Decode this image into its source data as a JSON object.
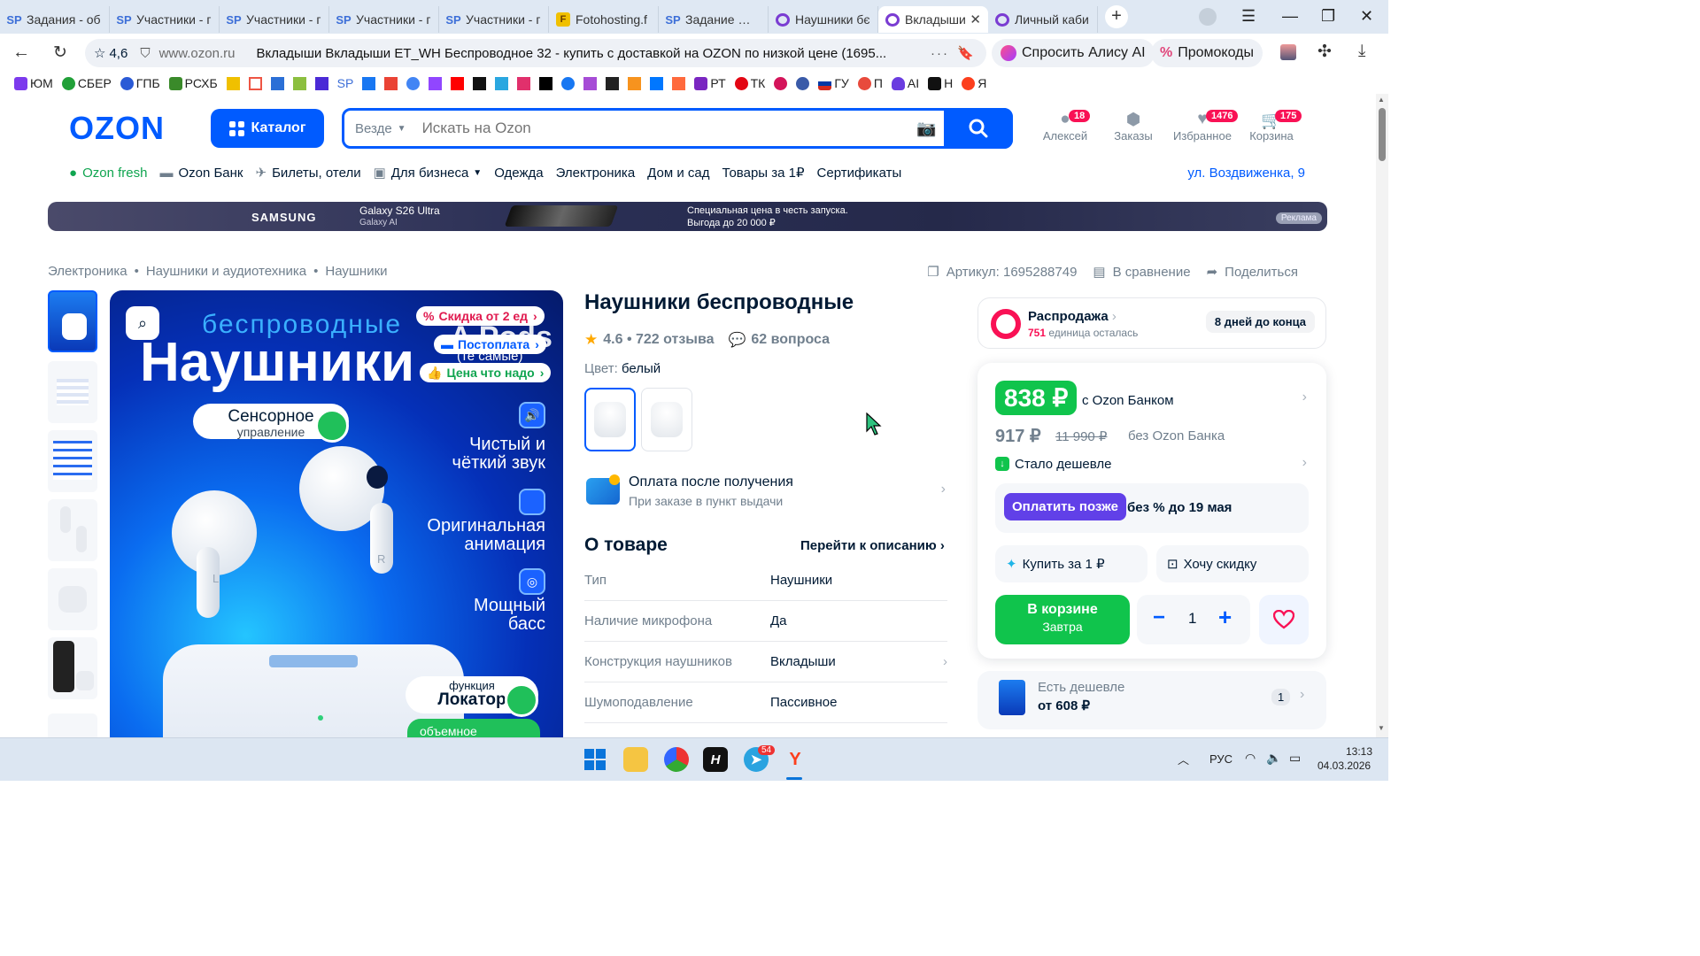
{
  "browser": {
    "tabs": [
      {
        "fav": "SP",
        "title": "Задания - об"
      },
      {
        "fav": "SP",
        "title": "Участники - г"
      },
      {
        "fav": "SP",
        "title": "Участники - г"
      },
      {
        "fav": "SP",
        "title": "Участники - г"
      },
      {
        "fav": "SP",
        "title": "Участники - г"
      },
      {
        "fav": "F",
        "title": "Fotohosting.f"
      },
      {
        "fav": "SP",
        "title": "Задание №2("
      },
      {
        "fav": "",
        "title": "Наушники бє"
      },
      {
        "fav": "",
        "title": "Вкладыши"
      },
      {
        "fav": "",
        "title": "Личный каби"
      }
    ],
    "rating_badge": "4,6",
    "url_domain": "www.ozon.ru",
    "page_title": "Вкладыши Вкладыши ET_WH Беспроводное 32 - купить с доставкой на OZON по низкой цене (1695...",
    "alice_label": "Спросить Алису AI",
    "promo_label": "Промокоды",
    "bookmarks": [
      "ЮМ",
      "СБЕР",
      "ГПБ",
      "РСХБ",
      "SP",
      "РТ",
      "ТК",
      "ГУ",
      "П",
      "AI",
      "Н",
      "Я"
    ]
  },
  "header": {
    "logo": "OZON",
    "catalog_label": "Каталог",
    "search_scope": "Везде",
    "search_placeholder": "Искать на Ozon",
    "profile_label": "Алексей",
    "profile_badge": "18",
    "orders_label": "Заказы",
    "favorites_label": "Избранное",
    "favorites_badge": "1476",
    "cart_label": "Корзина",
    "cart_badge": "175"
  },
  "nav": {
    "items": [
      "Ozon fresh",
      "Ozon Банк",
      "Билеты, отели",
      "Для бизнеса",
      "Одежда",
      "Электроника",
      "Дом и сад",
      "Товары за 1₽",
      "Сертификаты"
    ],
    "address": "ул. Воздвиженка, 9"
  },
  "banner": {
    "brand": "SAMSUNG",
    "model": "Galaxy S26 Ultra",
    "model_sub": "Galaxy AI",
    "offer_line1": "Специальная цена в честь запуска.",
    "offer_line2": "Выгода до 20 000 ₽",
    "ad_label": "Реклама"
  },
  "breadcrumbs": [
    "Электроника",
    "Наушники и аудиотехника",
    "Наушники"
  ],
  "meta": {
    "article": "Артикул: 1695288749",
    "compare": "В сравнение",
    "share": "Поделиться"
  },
  "hero": {
    "word_top": "беспроводные",
    "word_main": "Наушники",
    "word_ghost": "A Pods",
    "word_ghost_sub": "(те самые)",
    "chip_discount": "Скидка от 2 ед",
    "chip_postpay": "Постоплата",
    "chip_price": "Цена что надо",
    "sensor_title": "Сенсорное",
    "sensor_sub": "управление",
    "feature1": "Чистый и чёткий звук",
    "feature2": "Оригинальная анимация",
    "feature3": "Мощный басс",
    "locator_top": "функция",
    "locator_main": "Локатор",
    "bottom_badge": "объемное",
    "earbud_left": "L",
    "earbud_right": "R"
  },
  "product": {
    "title": "Наушники беспроводные",
    "rating": "4.6 • 722 отзыва",
    "questions": "62 вопроса",
    "color_label": "Цвет:",
    "color_value": "белый",
    "pay_after_title": "Оплата после получения",
    "pay_after_sub": "При заказе в пункт выдачи",
    "about_title": "О товаре",
    "about_link": "Перейти к описанию",
    "specs": [
      {
        "k": "Тип",
        "v": "Наушники"
      },
      {
        "k": "Наличие микрофона",
        "v": "Да"
      },
      {
        "k": "Конструкция наушников",
        "v": "Вкладыши"
      },
      {
        "k": "Шумоподавление",
        "v": "Пассивное"
      }
    ]
  },
  "buy": {
    "sale_title": "Распродажа",
    "sale_count": "751",
    "sale_rest": "единица осталась",
    "sale_deadline": "8 дней до конца",
    "price_bank": "838 ₽",
    "price_bank_label": "с Ozon Банком",
    "price": "917 ₽",
    "price_old": "11 990 ₽",
    "price_label": "без Ozon Банка",
    "cheaper_badge": "Стало дешевле",
    "pay_later_btn": "Оплатить позже",
    "pay_later_text": "без % до 19 мая",
    "buy_for_1": "Купить за 1 ₽",
    "want_discount": "Хочу скидку",
    "in_cart": "В корзине",
    "in_cart_sub": "Завтра",
    "qty": "1",
    "cheaper_title": "Есть дешевле",
    "cheaper_price": "от 608 ₽",
    "cheaper_count": "1"
  },
  "taskbar": {
    "telegram_badge": "54",
    "lang": "РУС",
    "time": "13:13",
    "date": "04.03.2026"
  }
}
